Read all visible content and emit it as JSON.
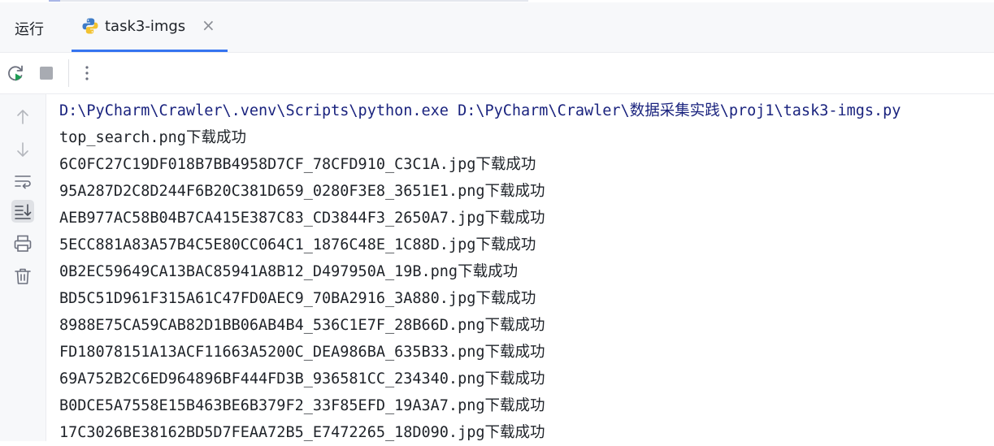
{
  "header": {
    "run_label": "运行",
    "tab": {
      "label": "task3-imgs",
      "icon": "python-icon"
    }
  },
  "toolbar": {
    "buttons": [
      "rerun-icon",
      "stop-icon",
      "more-vertical-icon"
    ]
  },
  "gutter": {
    "buttons": [
      "arrow-up-icon",
      "arrow-down-icon",
      "soft-wrap-icon",
      "scroll-to-end-icon",
      "print-icon",
      "trash-icon"
    ]
  },
  "console": {
    "command": "D:\\PyCharm\\Crawler\\.venv\\Scripts\\python.exe D:\\PyCharm\\Crawler\\数据采集实践\\proj1\\task3-imgs.py",
    "success_suffix": "下载成功",
    "files": [
      "top_search.png",
      "6C0FC27C19DF018B7BB4958D7CF_78CFD910_C3C1A.jpg",
      "95A287D2C8D244F6B20C381D659_0280F3E8_3651E1.png",
      "AEB977AC58B04B7CA415E387C83_CD3844F3_2650A7.jpg",
      "5ECC881A83A57B4C5E80CC064C1_1876C48E_1C88D.jpg",
      "0B2EC59649CA13BAC85941A8B12_D497950A_19B.png",
      "BD5C51D961F315A61C47FD0AEC9_70BA2916_3A880.jpg",
      "8988E75CA59CAB82D1BB06AB4B4_536C1E7F_28B66D.png",
      "FD18078151A13ACF11663A5200C_DEA986BA_635B33.png",
      "69A752B2C6ED964896BF444FD3B_936581CC_234340.png",
      "B0DCE5A7558E15B463BE6B379F2_33F85EFD_19A3A7.png",
      "17C3026BE38162BD5D7FEAA72B5_E7472265_18D090.jpg"
    ]
  },
  "colors": {
    "accent": "#3574f0",
    "command_text": "#1a237e",
    "text": "#1f2329"
  }
}
